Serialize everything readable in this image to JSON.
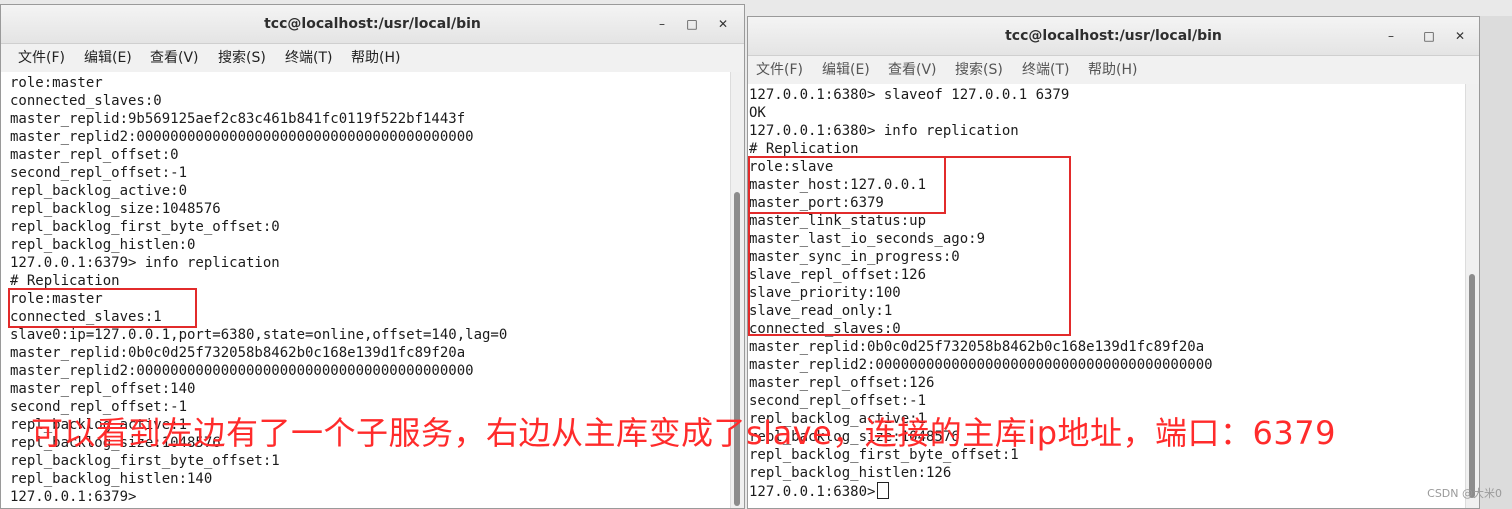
{
  "left": {
    "title": "tcc@localhost:/usr/local/bin",
    "controls": {
      "minimize": "–",
      "maximize": "□",
      "close": "✕"
    },
    "menu": [
      "文件(F)",
      "编辑(E)",
      "查看(V)",
      "搜索(S)",
      "终端(T)",
      "帮助(H)"
    ],
    "lines": [
      "role:master",
      "connected_slaves:0",
      "master_replid:9b569125aef2c83c461b841fc0119f522bf1443f",
      "master_replid2:0000000000000000000000000000000000000000",
      "master_repl_offset:0",
      "second_repl_offset:-1",
      "repl_backlog_active:0",
      "repl_backlog_size:1048576",
      "repl_backlog_first_byte_offset:0",
      "repl_backlog_histlen:0",
      "127.0.0.1:6379> info replication",
      "# Replication",
      "role:master",
      "connected_slaves:1",
      "slave0:ip=127.0.0.1,port=6380,state=online,offset=140,lag=0",
      "master_replid:0b0c0d25f732058b8462b0c168e139d1fc89f20a",
      "master_replid2:0000000000000000000000000000000000000000",
      "master_repl_offset:140",
      "second_repl_offset:-1",
      "repl_backlog_active:1",
      "repl_backlog_size:1048576",
      "repl_backlog_first_byte_offset:1",
      "repl_backlog_histlen:140",
      "127.0.0.1:6379>"
    ]
  },
  "right": {
    "title": "tcc@localhost:/usr/local/bin",
    "controls": {
      "minimize": "–",
      "maximize": "□",
      "close": "✕"
    },
    "menu": [
      "文件(F)",
      "编辑(E)",
      "查看(V)",
      "搜索(S)",
      "终端(T)",
      "帮助(H)"
    ],
    "lines": [
      "127.0.0.1:6380> slaveof 127.0.0.1 6379",
      "OK",
      "127.0.0.1:6380> info replication",
      "# Replication",
      "role:slave",
      "master_host:127.0.0.1",
      "master_port:6379",
      "master_link_status:up",
      "master_last_io_seconds_ago:9",
      "master_sync_in_progress:0",
      "slave_repl_offset:126",
      "slave_priority:100",
      "slave_read_only:1",
      "connected_slaves:0",
      "master_replid:0b0c0d25f732058b8462b0c168e139d1fc89f20a",
      "master_replid2:0000000000000000000000000000000000000000",
      "master_repl_offset:126",
      "second_repl_offset:-1",
      "repl_backlog_active:1",
      "repl_backlog_size:1048576",
      "repl_backlog_first_byte_offset:1",
      "repl_backlog_histlen:126",
      "127.0.0.1:6380>"
    ]
  },
  "annotation": "可以看到左边有了一个子服务，右边从主库变成了slave，连接的主库ip地址，端口：6379",
  "watermark": "CSDN @大米0",
  "colors": {
    "annotation": "#ff2b2b",
    "highlight_box": "#e22b2b"
  }
}
